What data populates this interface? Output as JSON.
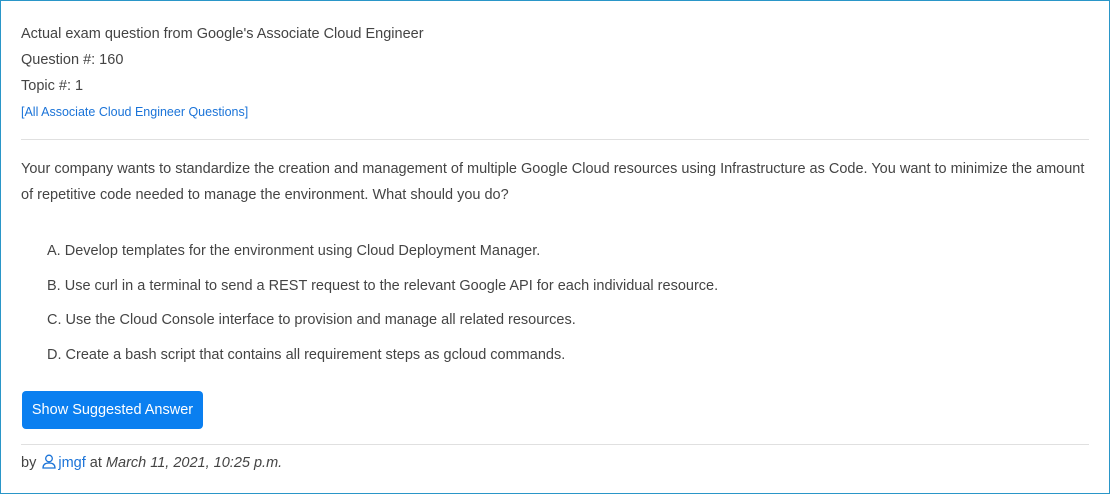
{
  "header": {
    "line1": "Actual exam question from Google's Associate Cloud Engineer",
    "line2": "Question #: 160",
    "line3": "Topic #: 1",
    "all_questions_link": "[All Associate Cloud Engineer Questions]"
  },
  "question": {
    "text": "Your company wants to standardize the creation and management of multiple Google Cloud resources using Infrastructure as Code. You want to minimize the amount of repetitive code needed to manage the environment. What should you do?"
  },
  "choices": [
    "A. Develop templates for the environment using Cloud Deployment Manager.",
    "B. Use curl in a terminal to send a REST request to the relevant Google API for each individual resource.",
    "C. Use the Cloud Console interface to provision and manage all related resources.",
    "D. Create a bash script that contains all requirement steps as gcloud commands."
  ],
  "button": {
    "label": "Show Suggested Answer"
  },
  "meta": {
    "by": "by",
    "user_icon": "user-icon",
    "username": "jmgf",
    "at": "at",
    "date": "March 11, 2021, 10:25 p.m."
  },
  "colors": {
    "accent": "#0a7ff0",
    "link": "#1a73d8",
    "border": "#2a96c8",
    "text": "#444444"
  }
}
